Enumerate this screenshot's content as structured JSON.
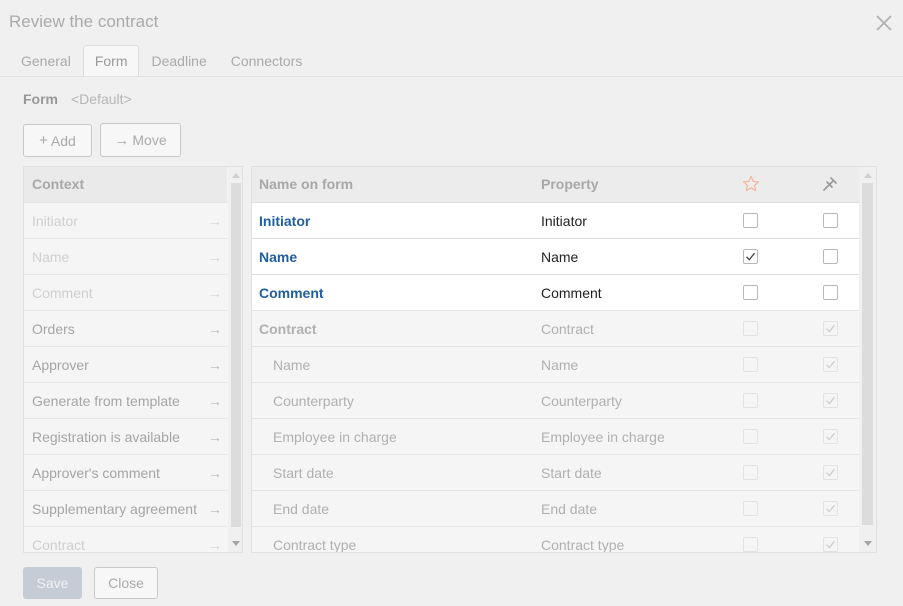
{
  "dialog": {
    "title": "Review the contract",
    "close_icon": "close-icon"
  },
  "tabs": [
    {
      "label": "General",
      "active": false
    },
    {
      "label": "Form",
      "active": true
    },
    {
      "label": "Deadline",
      "active": false
    },
    {
      "label": "Connectors",
      "active": false
    }
  ],
  "form_selector": {
    "label": "Form",
    "value": "<Default>"
  },
  "toolbar": {
    "add_label": "Add",
    "add_glyph": "+",
    "move_label": "Move",
    "move_glyph": "→"
  },
  "context": {
    "header": "Context",
    "arrow_glyph": "→",
    "items": [
      {
        "label": "Initiator",
        "dim": true
      },
      {
        "label": "Name",
        "dim": true
      },
      {
        "label": "Comment",
        "dim": true
      },
      {
        "label": "Orders",
        "dim": false
      },
      {
        "label": "Approver",
        "dim": false
      },
      {
        "label": "Generate from template",
        "dim": false
      },
      {
        "label": "Registration is available",
        "dim": false
      },
      {
        "label": "Approver's comment",
        "dim": false
      },
      {
        "label": "Supplementary agreement",
        "dim": false
      },
      {
        "label": "Contract",
        "dim": true
      }
    ]
  },
  "table": {
    "columns": {
      "name": "Name on form",
      "property": "Property",
      "required_icon": "star-icon",
      "readonly_icon": "pin-icon"
    },
    "rows": [
      {
        "name": "Initiator",
        "property": "Initiator",
        "kind": "active",
        "required": false,
        "readonly": false
      },
      {
        "name": "Name",
        "property": "Name",
        "kind": "active",
        "required": true,
        "readonly": false
      },
      {
        "name": "Comment",
        "property": "Comment",
        "kind": "active",
        "required": false,
        "readonly": false
      },
      {
        "name": "Contract",
        "property": "Contract",
        "kind": "parent",
        "required": false,
        "readonly": true
      },
      {
        "name": "Name",
        "property": "Name",
        "kind": "child",
        "required": false,
        "readonly": true
      },
      {
        "name": "Counterparty",
        "property": "Counterparty",
        "kind": "child",
        "required": false,
        "readonly": true
      },
      {
        "name": "Employee in charge",
        "property": "Employee in charge",
        "kind": "child",
        "required": false,
        "readonly": true
      },
      {
        "name": "Start date",
        "property": "Start date",
        "kind": "child",
        "required": false,
        "readonly": true
      },
      {
        "name": "End date",
        "property": "End date",
        "kind": "child",
        "required": false,
        "readonly": true
      },
      {
        "name": "Contract type",
        "property": "Contract type",
        "kind": "child",
        "required": false,
        "readonly": true
      }
    ]
  },
  "footer": {
    "save_label": "Save",
    "close_label": "Close"
  },
  "colors": {
    "link": "#1f5f9e",
    "save_bg": "#c6ccd6"
  }
}
